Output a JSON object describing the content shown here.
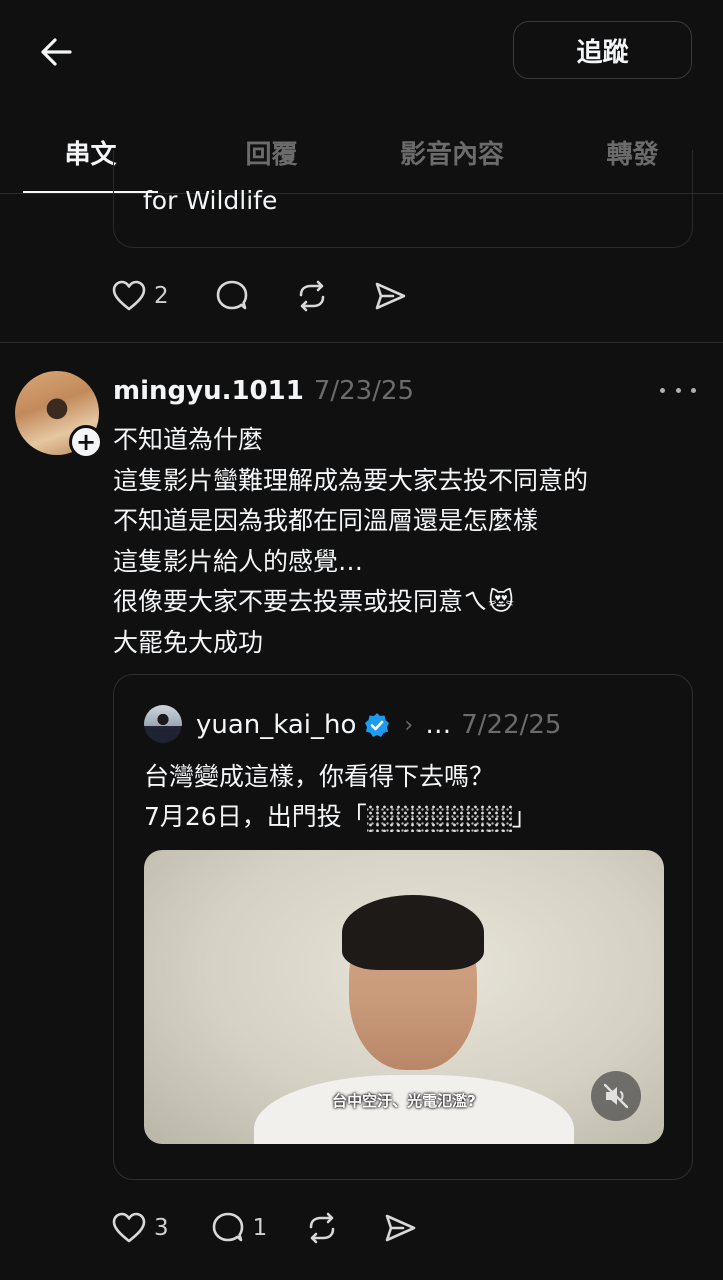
{
  "header": {
    "follow_label": "追蹤"
  },
  "tabs": [
    {
      "label": "串文"
    },
    {
      "label": "回覆"
    },
    {
      "label": "影音內容"
    },
    {
      "label": "轉發"
    }
  ],
  "previous_post": {
    "card_text": "for Wildlife",
    "likes": "2"
  },
  "post": {
    "username": "mingyu.1011",
    "date": "7/23/25",
    "lines": [
      "不知道為什麼",
      "這隻影片蠻難理解成為要大家去投不同意的",
      "不知道是因為我都在同溫層還是怎麼樣",
      "這隻影片給人的感覺…",
      "很像要大家不要去投票或投同意ㄟ😻",
      "大罷免大成功"
    ],
    "likes": "3",
    "replies": "1"
  },
  "quote": {
    "username": "yuan_kai_ho",
    "ellipsis": "…",
    "date": "7/22/25",
    "line1": "台灣變成這樣，你看得下去嗎？",
    "line2_prefix": "7月26日，出門投「",
    "line2_suffix": "」",
    "video_caption": "台中空汙、光電氾濫?"
  },
  "colors": {
    "background": "#101010",
    "text": "#f3f5f7",
    "muted": "#6b6b6b",
    "verified": "#1d9bf0"
  }
}
